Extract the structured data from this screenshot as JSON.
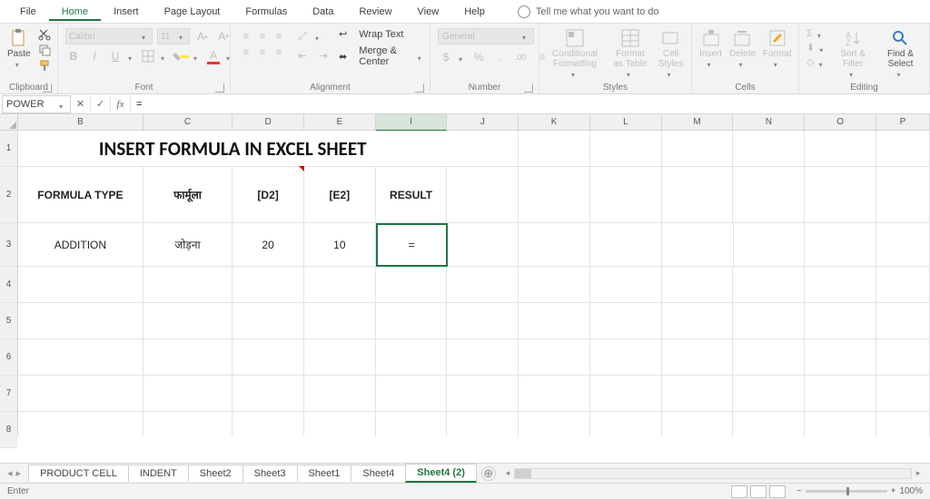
{
  "menu": {
    "file": "File",
    "home": "Home",
    "insert": "Insert",
    "pageLayout": "Page Layout",
    "formulas": "Formulas",
    "data": "Data",
    "review": "Review",
    "view": "View",
    "help": "Help",
    "tell": "Tell me what you want to do"
  },
  "ribbon": {
    "clipboard": {
      "paste": "Paste",
      "label": "Clipboard"
    },
    "font": {
      "name": "Calibri",
      "size": "11",
      "label": "Font"
    },
    "alignment": {
      "wrap": "Wrap Text",
      "merge": "Merge & Center",
      "label": "Alignment"
    },
    "number": {
      "format": "General",
      "label": "Number"
    },
    "styles": {
      "cond": "Conditional Formatting",
      "table": "Format as Table",
      "cell": "Cell Styles",
      "label": "Styles"
    },
    "cells": {
      "insert": "Insert",
      "delete": "Delete",
      "format": "Format",
      "label": "Cells"
    },
    "editing": {
      "sort": "Sort & Filter",
      "find": "Find & Select",
      "label": "Editing"
    }
  },
  "formulaBar": {
    "name": "POWER",
    "value": "="
  },
  "columns": [
    "B",
    "C",
    "D",
    "E",
    "I",
    "J",
    "K",
    "L",
    "M",
    "N",
    "O",
    "P"
  ],
  "rows": [
    "1",
    "2",
    "3",
    "4",
    "5",
    "6",
    "7",
    "8"
  ],
  "sheet": {
    "title": "INSERT FORMULA IN EXCEL SHEET",
    "hdr": {
      "B": "FORMULA TYPE",
      "C": "फार्मूला",
      "D": "[D2]",
      "E": "[E2]",
      "I": "RESULT"
    },
    "r3": {
      "B": "ADDITION",
      "C": "जोड़ना",
      "D": "20",
      "E": "10",
      "I": "="
    }
  },
  "tabs": [
    "PRODUCT CELL",
    "INDENT",
    "Sheet2",
    "Sheet3",
    "Sheet1",
    "Sheet4",
    "Sheet4 (2)"
  ],
  "status": {
    "mode": "Enter",
    "zoom": "100%"
  }
}
